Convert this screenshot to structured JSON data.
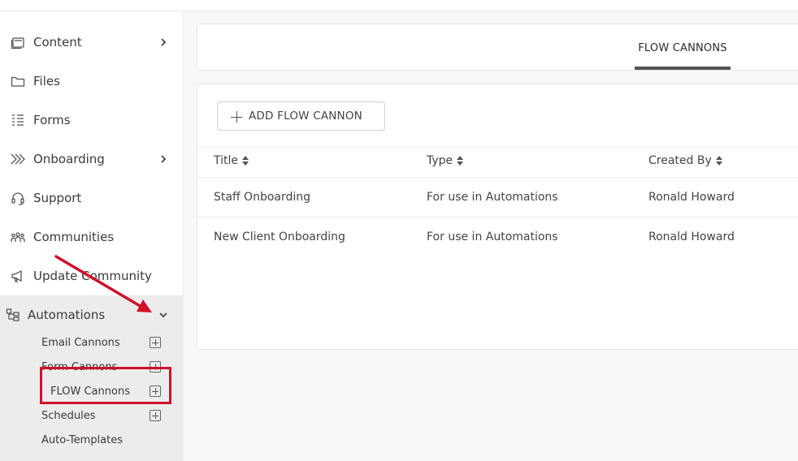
{
  "sidebar": {
    "items": [
      {
        "label": "Content",
        "icon": "content-icon",
        "has_chevron": true
      },
      {
        "label": "Files",
        "icon": "folder-icon",
        "has_chevron": false
      },
      {
        "label": "Forms",
        "icon": "forms-icon",
        "has_chevron": false
      },
      {
        "label": "Onboarding",
        "icon": "onboarding-icon",
        "has_chevron": true
      },
      {
        "label": "Support",
        "icon": "headset-icon",
        "has_chevron": false
      },
      {
        "label": "Communities",
        "icon": "communities-icon",
        "has_chevron": false
      },
      {
        "label": "Update Community",
        "icon": "megaphone-icon",
        "has_chevron": false
      }
    ],
    "automations": {
      "label": "Automations",
      "icon": "automations-icon",
      "expanded": true,
      "children": [
        {
          "label": "Email Cannons",
          "has_add": true
        },
        {
          "label": "Form Cannons",
          "has_add": true
        },
        {
          "label": "FLOW Cannons",
          "has_add": true,
          "highlighted": true
        },
        {
          "label": "Schedules",
          "has_add": true
        },
        {
          "label": "Auto-Templates",
          "has_add": false
        }
      ]
    }
  },
  "tabs": [
    {
      "label": "FLOW CANNONS",
      "active": true
    }
  ],
  "toolbar": {
    "add_label": "ADD FLOW CANNON"
  },
  "table": {
    "columns": [
      "Title",
      "Type",
      "Created By"
    ],
    "rows": [
      [
        "Staff Onboarding",
        "For use in Automations",
        "Ronald Howard"
      ],
      [
        "New Client Onboarding",
        "For use in Automations",
        "Ronald Howard"
      ]
    ]
  },
  "annotation": {
    "highlight_color": "#d0102a",
    "arrow_color": "#d0102a"
  }
}
